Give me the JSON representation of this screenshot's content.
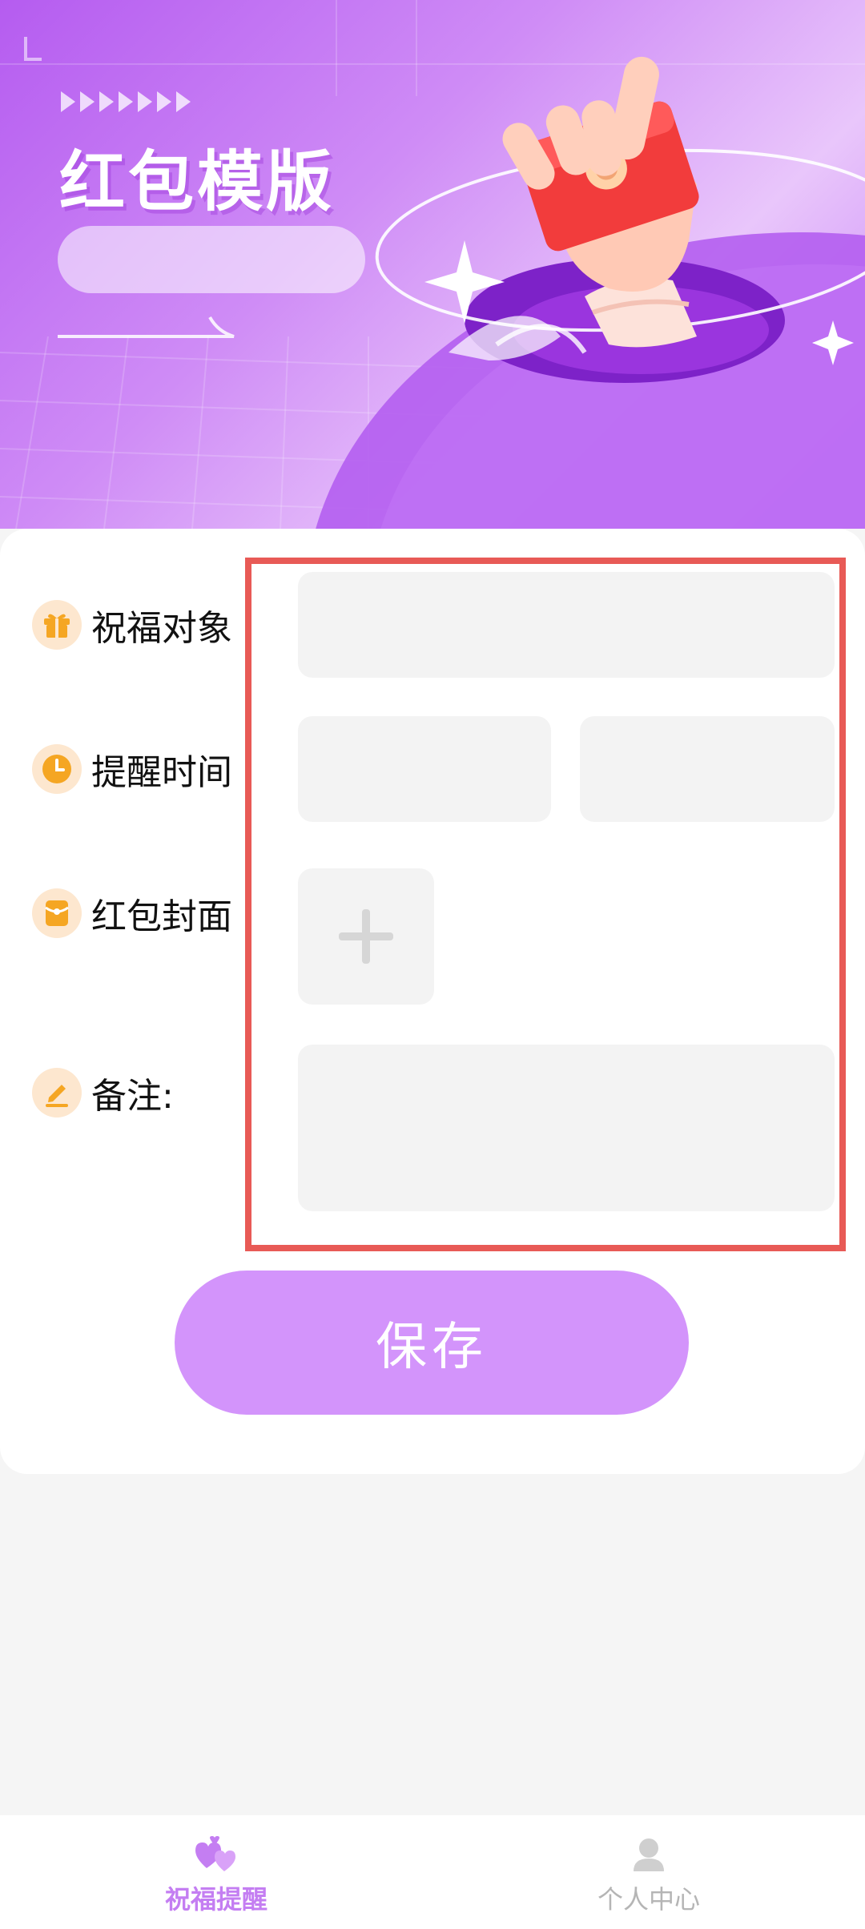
{
  "banner": {
    "title": "红包模版"
  },
  "form": {
    "recipient_label": "祝福对象",
    "reminder_time_label": "提醒时间",
    "cover_label": "红包封面",
    "note_label": "备注:"
  },
  "save_button": "保存",
  "tabs": [
    {
      "label": "祝福提醒",
      "icon": "hearts-icon",
      "active": true
    },
    {
      "label": "个人中心",
      "icon": "person-icon",
      "active": false
    }
  ],
  "colors": {
    "brand": "#c47ef2",
    "button": "#d394fb",
    "highlight": "#e85a56",
    "icon_orange": "#f5a623"
  }
}
